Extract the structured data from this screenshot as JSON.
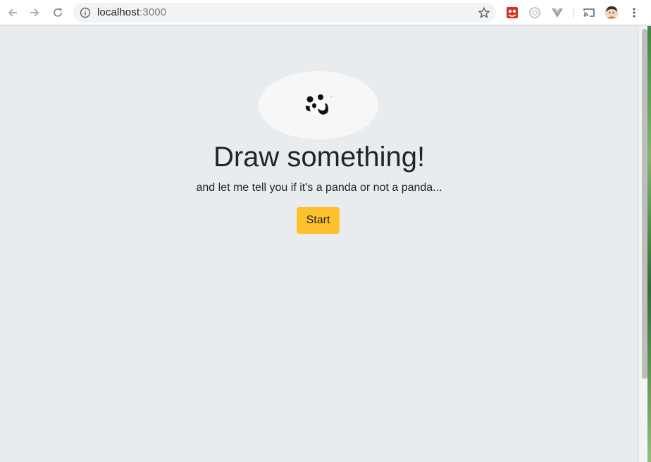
{
  "browser": {
    "url_host": "localhost",
    "url_port": ":3000",
    "icons": {
      "back": "arrow-left-icon",
      "forward": "arrow-right-icon",
      "reload": "reload-icon",
      "info": "info-icon",
      "bookmark": "star-icon",
      "cast": "cast-icon",
      "menu": "kebab-menu-icon"
    },
    "extensions": [
      "red-extension-icon",
      "circle-extension-icon",
      "vue-devtools-icon"
    ]
  },
  "hero": {
    "logo": "panda-logo",
    "title": "Draw something!",
    "subtitle": "and let me tell you if it's a panda or not a panda...",
    "start_label": "Start"
  },
  "colors": {
    "page_background": "#e9ecef",
    "start_button": "#ffc02e",
    "text": "#212529"
  }
}
